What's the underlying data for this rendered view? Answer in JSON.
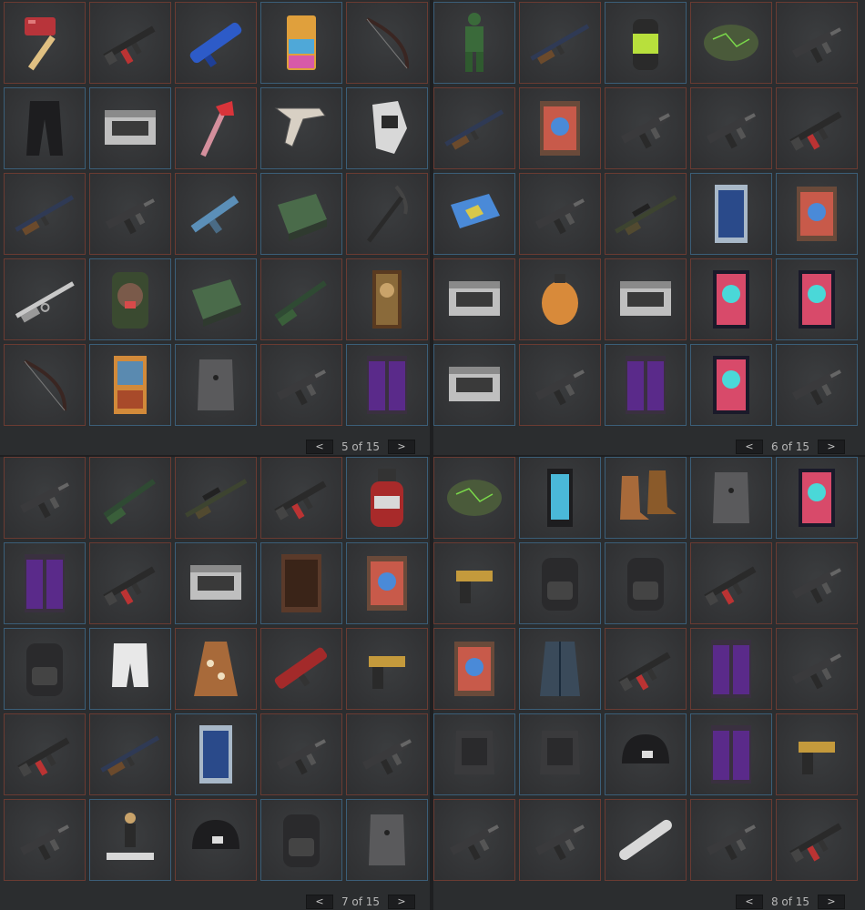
{
  "colors": {
    "background": "#2b2d2f",
    "border_red": "#6a3b32",
    "border_blue": "#3b5e78",
    "pager_button": "#1c1d1f"
  },
  "pager": {
    "prev_glyph": "<",
    "next_glyph": ">"
  },
  "panels": [
    {
      "page_label": "5 of 15",
      "items": [
        {
          "icon": "hammer-icon",
          "rarity": "red"
        },
        {
          "icon": "assault-rifle-icon",
          "rarity": "red"
        },
        {
          "icon": "blue-tube-weapon-icon",
          "rarity": "red"
        },
        {
          "icon": "fridge-icon",
          "rarity": "blue"
        },
        {
          "icon": "bow-icon",
          "rarity": "red"
        },
        {
          "icon": "pants-icon",
          "rarity": "blue"
        },
        {
          "icon": "storage-box-icon",
          "rarity": "blue"
        },
        {
          "icon": "hatchet-icon",
          "rarity": "red"
        },
        {
          "icon": "bone-tool-icon",
          "rarity": "blue"
        },
        {
          "icon": "gloves-icon",
          "rarity": "blue"
        },
        {
          "icon": "rifle-icon",
          "rarity": "red"
        },
        {
          "icon": "smg-icon",
          "rarity": "red"
        },
        {
          "icon": "blue-gun-icon",
          "rarity": "red"
        },
        {
          "icon": "bed-icon",
          "rarity": "blue"
        },
        {
          "icon": "pickaxe-icon",
          "rarity": "red"
        },
        {
          "icon": "lever-rifle-icon",
          "rarity": "red"
        },
        {
          "icon": "gorilla-bag-icon",
          "rarity": "blue"
        },
        {
          "icon": "bed-icon",
          "rarity": "blue"
        },
        {
          "icon": "shotgun-icon",
          "rarity": "red"
        },
        {
          "icon": "portrait-icon",
          "rarity": "red"
        },
        {
          "icon": "bow-icon",
          "rarity": "red"
        },
        {
          "icon": "claw-machine-icon",
          "rarity": "blue"
        },
        {
          "icon": "vest-icon",
          "rarity": "blue"
        },
        {
          "icon": "smg-icon",
          "rarity": "red"
        },
        {
          "icon": "locker-icon",
          "rarity": "blue"
        }
      ]
    },
    {
      "page_label": "6 of 15",
      "items": [
        {
          "icon": "suit-icon",
          "rarity": "blue"
        },
        {
          "icon": "rifle-icon",
          "rarity": "red"
        },
        {
          "icon": "can-icon",
          "rarity": "blue"
        },
        {
          "icon": "rock-icon",
          "rarity": "red"
        },
        {
          "icon": "smg-icon",
          "rarity": "red"
        },
        {
          "icon": "rifle-icon",
          "rarity": "red"
        },
        {
          "icon": "painting-icon",
          "rarity": "red"
        },
        {
          "icon": "smg-icon",
          "rarity": "red"
        },
        {
          "icon": "smg-icon",
          "rarity": "red"
        },
        {
          "icon": "assault-rifle-icon",
          "rarity": "red"
        },
        {
          "icon": "map-icon",
          "rarity": "blue"
        },
        {
          "icon": "smg-icon",
          "rarity": "red"
        },
        {
          "icon": "sniper-icon",
          "rarity": "red"
        },
        {
          "icon": "vending-machine-icon",
          "rarity": "blue"
        },
        {
          "icon": "painting-icon",
          "rarity": "blue"
        },
        {
          "icon": "storage-box-icon",
          "rarity": "red"
        },
        {
          "icon": "grenade-icon",
          "rarity": "red"
        },
        {
          "icon": "storage-box-icon",
          "rarity": "red"
        },
        {
          "icon": "poster-icon",
          "rarity": "red"
        },
        {
          "icon": "poster-icon",
          "rarity": "blue"
        },
        {
          "icon": "storage-box-icon",
          "rarity": "blue"
        },
        {
          "icon": "smg-icon",
          "rarity": "red"
        },
        {
          "icon": "locker-icon",
          "rarity": "blue"
        },
        {
          "icon": "poster-icon",
          "rarity": "blue"
        },
        {
          "icon": "smg-icon",
          "rarity": "blue"
        }
      ]
    },
    {
      "page_label": "7 of 15",
      "items": [
        {
          "icon": "smg-icon",
          "rarity": "red"
        },
        {
          "icon": "shotgun-icon",
          "rarity": "red"
        },
        {
          "icon": "sniper-icon",
          "rarity": "red"
        },
        {
          "icon": "assault-rifle-icon",
          "rarity": "red"
        },
        {
          "icon": "bottle-icon",
          "rarity": "blue"
        },
        {
          "icon": "locker-icon",
          "rarity": "blue"
        },
        {
          "icon": "assault-rifle-icon",
          "rarity": "red"
        },
        {
          "icon": "storage-box-icon",
          "rarity": "blue"
        },
        {
          "icon": "door-icon",
          "rarity": "blue"
        },
        {
          "icon": "painting-icon",
          "rarity": "blue"
        },
        {
          "icon": "backpack-icon",
          "rarity": "blue"
        },
        {
          "icon": "shorts-icon",
          "rarity": "blue"
        },
        {
          "icon": "robe-icon",
          "rarity": "red"
        },
        {
          "icon": "rocket-launcher-icon",
          "rarity": "red"
        },
        {
          "icon": "pistol-icon",
          "rarity": "red"
        },
        {
          "icon": "assault-rifle-icon",
          "rarity": "red"
        },
        {
          "icon": "rifle-icon",
          "rarity": "red"
        },
        {
          "icon": "vending-machine-icon",
          "rarity": "blue"
        },
        {
          "icon": "smg-icon",
          "rarity": "red"
        },
        {
          "icon": "smg-icon",
          "rarity": "red"
        },
        {
          "icon": "smg-icon",
          "rarity": "red"
        },
        {
          "icon": "figure-scene-icon",
          "rarity": "blue"
        },
        {
          "icon": "helmet-icon",
          "rarity": "red"
        },
        {
          "icon": "backpack-icon",
          "rarity": "blue"
        },
        {
          "icon": "vest-icon",
          "rarity": "blue"
        }
      ]
    },
    {
      "page_label": "8 of 15",
      "items": [
        {
          "icon": "rock-icon",
          "rarity": "red"
        },
        {
          "icon": "lantern-icon",
          "rarity": "blue"
        },
        {
          "icon": "boots-icon",
          "rarity": "blue"
        },
        {
          "icon": "vest-icon",
          "rarity": "blue"
        },
        {
          "icon": "poster-icon",
          "rarity": "blue"
        },
        {
          "icon": "pistol-icon",
          "rarity": "red"
        },
        {
          "icon": "backpack-icon",
          "rarity": "blue"
        },
        {
          "icon": "backpack-icon",
          "rarity": "blue"
        },
        {
          "icon": "assault-rifle-icon",
          "rarity": "red"
        },
        {
          "icon": "smg-icon",
          "rarity": "red"
        },
        {
          "icon": "painting-icon",
          "rarity": "red"
        },
        {
          "icon": "coat-icon",
          "rarity": "blue"
        },
        {
          "icon": "assault-rifle-icon",
          "rarity": "red"
        },
        {
          "icon": "locker-icon",
          "rarity": "red"
        },
        {
          "icon": "smg-icon",
          "rarity": "red"
        },
        {
          "icon": "armor-icon",
          "rarity": "blue"
        },
        {
          "icon": "armor-icon",
          "rarity": "blue"
        },
        {
          "icon": "helmet-icon",
          "rarity": "blue"
        },
        {
          "icon": "locker-icon",
          "rarity": "blue"
        },
        {
          "icon": "pistol-icon",
          "rarity": "red"
        },
        {
          "icon": "smg-icon",
          "rarity": "red"
        },
        {
          "icon": "smg-icon",
          "rarity": "red"
        },
        {
          "icon": "pipe-icon",
          "rarity": "red"
        },
        {
          "icon": "smg-icon",
          "rarity": "red"
        },
        {
          "icon": "assault-rifle-icon",
          "rarity": "red"
        }
      ]
    }
  ]
}
